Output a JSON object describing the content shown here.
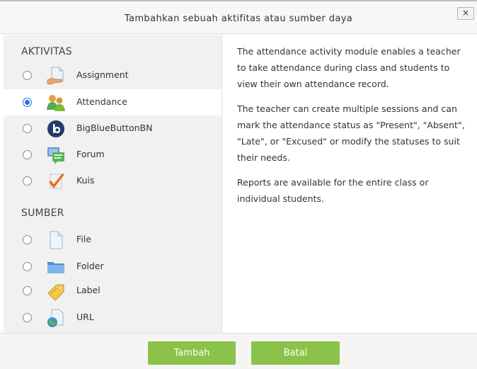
{
  "dialog": {
    "title": "Tambahkan sebuah aktifitas atau sumber daya",
    "close_label": "×"
  },
  "sections": {
    "activities_label": "AKTIVITAS",
    "resources_label": "SUMBER"
  },
  "activities": [
    {
      "label": "Assignment",
      "icon": "assignment-icon",
      "selected": false
    },
    {
      "label": "Attendance",
      "icon": "attendance-icon",
      "selected": true
    },
    {
      "label": "BigBlueButtonBN",
      "icon": "bigbluebutton-icon",
      "selected": false
    },
    {
      "label": "Forum",
      "icon": "forum-icon",
      "selected": false
    },
    {
      "label": "Kuis",
      "icon": "quiz-icon",
      "selected": false
    }
  ],
  "resources": [
    {
      "label": "File",
      "icon": "file-icon",
      "selected": false
    },
    {
      "label": "Folder",
      "icon": "folder-icon",
      "selected": false
    },
    {
      "label": "Label",
      "icon": "label-icon",
      "selected": false
    },
    {
      "label": "URL",
      "icon": "url-icon",
      "selected": false
    }
  ],
  "description": {
    "p1": "The attendance activity module enables a teacher to take attendance during class and students to view their own attendance record.",
    "p2": "The teacher can create multiple sessions and can mark the attendance status as \"Present\", \"Absent\", \"Late\", or \"Excused\" or modify the statuses to suit their needs.",
    "p3": "Reports are available for the entire class or individual students."
  },
  "buttons": {
    "add_label": "Tambah",
    "cancel_label": "Batal"
  },
  "colors": {
    "button_green": "#8bc34a",
    "radio_blue": "#2a73d6",
    "panel_gray": "#f1f1f1"
  }
}
